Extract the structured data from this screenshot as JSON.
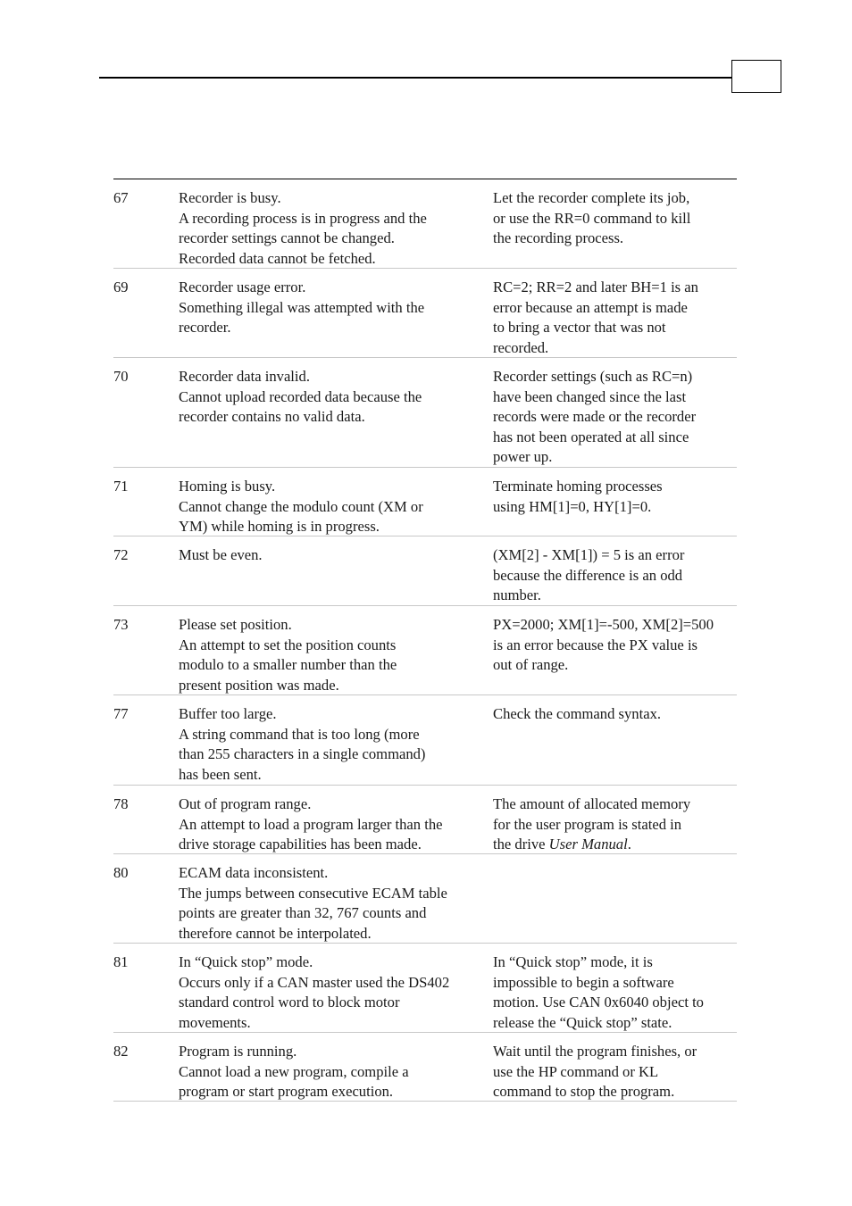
{
  "header": {
    "page_number": ""
  },
  "errors": [
    {
      "code": "67",
      "description": [
        "Recorder is busy.",
        "A recording process is in progress and the",
        "recorder settings cannot be changed.",
        "Recorded data cannot be fetched."
      ],
      "correction": [
        "Let the recorder complete its job,",
        "or use the RR=0 command to kill",
        "the recording process."
      ]
    },
    {
      "code": "69",
      "description": [
        "Recorder usage error.",
        "Something illegal was attempted with the",
        "recorder."
      ],
      "correction": [
        "RC=2; RR=2 and later BH=1 is an",
        "error because an attempt is made",
        "to bring a vector that was not",
        "recorded."
      ]
    },
    {
      "code": "70",
      "description": [
        "Recorder data invalid.",
        "Cannot upload recorded data because the",
        "recorder contains no valid data."
      ],
      "correction": [
        "Recorder settings (such as RC=n)",
        "have been changed since the last",
        "records were made or the recorder",
        "has not been operated at all since",
        "power up."
      ]
    },
    {
      "code": "71",
      "description": [
        "Homing is busy.",
        "Cannot change the modulo count (XM or",
        "YM) while homing is in progress."
      ],
      "correction": [
        "Terminate homing processes",
        "using HM[1]=0, HY[1]=0."
      ]
    },
    {
      "code": "72",
      "description": [
        "Must be even."
      ],
      "correction": [
        "(XM[2] - XM[1]) = 5 is an error",
        "because the difference is an odd",
        "number."
      ]
    },
    {
      "code": "73",
      "description": [
        "Please set position.",
        "An attempt to set the position counts",
        "modulo to a smaller number than the",
        "present position was made."
      ],
      "correction": [
        "PX=2000; XM[1]=-500, XM[2]=500",
        "is an error because the PX value is",
        "out of range."
      ]
    },
    {
      "code": "77",
      "description": [
        "Buffer too large.",
        "A string command that is too long (more",
        "than 255 characters in a single command)",
        "has been sent."
      ],
      "correction": [
        "Check the command syntax."
      ]
    },
    {
      "code": "78",
      "description": [
        "Out of program range.",
        "An attempt to load a program larger than the",
        "drive storage capabilities has been made."
      ],
      "correction": [
        "The amount of allocated memory",
        "for the user program is stated in"
      ],
      "correction_last_prefix": "the drive ",
      "correction_last_italic": "User Manual",
      "correction_last_suffix": "."
    },
    {
      "code": "80",
      "description": [
        "ECAM data inconsistent.",
        "The jumps between consecutive ECAM table",
        "points are greater than 32, 767 counts and",
        "therefore cannot be interpolated."
      ],
      "correction": []
    },
    {
      "code": "81",
      "description": [
        "In “Quick stop” mode.",
        "Occurs only if a CAN master used the DS402",
        "standard control word to block motor",
        "movements."
      ],
      "correction": [
        "In “Quick stop” mode, it is",
        "impossible to begin a software",
        "motion. Use CAN 0x6040 object to",
        "release the “Quick stop” state."
      ]
    },
    {
      "code": "82",
      "description": [
        "Program is running.",
        "Cannot load a new program, compile a",
        "program or start program execution."
      ],
      "correction": [
        "Wait until the program finishes, or",
        "use the HP command or KL",
        "command to stop the program."
      ]
    }
  ]
}
